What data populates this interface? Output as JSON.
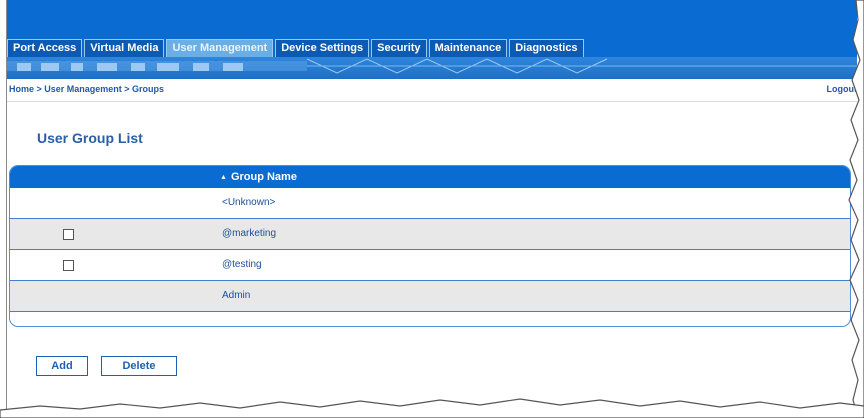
{
  "nav": {
    "tabs": [
      {
        "label": "Port Access"
      },
      {
        "label": "Virtual Media"
      },
      {
        "label": "User Management",
        "active": true
      },
      {
        "label": "Device Settings"
      },
      {
        "label": "Security"
      },
      {
        "label": "Maintenance"
      },
      {
        "label": "Diagnostics"
      }
    ]
  },
  "breadcrumb": "Home > User Management > Groups",
  "logout_label": "Logout",
  "page_title": "User Group List",
  "table": {
    "header": "Group Name",
    "sort_icon": "sort-ascending-icon",
    "rows": [
      {
        "name": "<Unknown>",
        "checkbox": false
      },
      {
        "name": "@marketing",
        "checkbox": true
      },
      {
        "name": "@testing",
        "checkbox": true
      },
      {
        "name": "Admin",
        "checkbox": false
      }
    ]
  },
  "buttons": {
    "add_label": "Add",
    "delete_label": "Delete"
  },
  "colors": {
    "brand_blue": "#0a6bd2",
    "active_tab": "#6aaee6",
    "link_text": "#1a4f99",
    "alt_row": "#e8e8e8"
  }
}
